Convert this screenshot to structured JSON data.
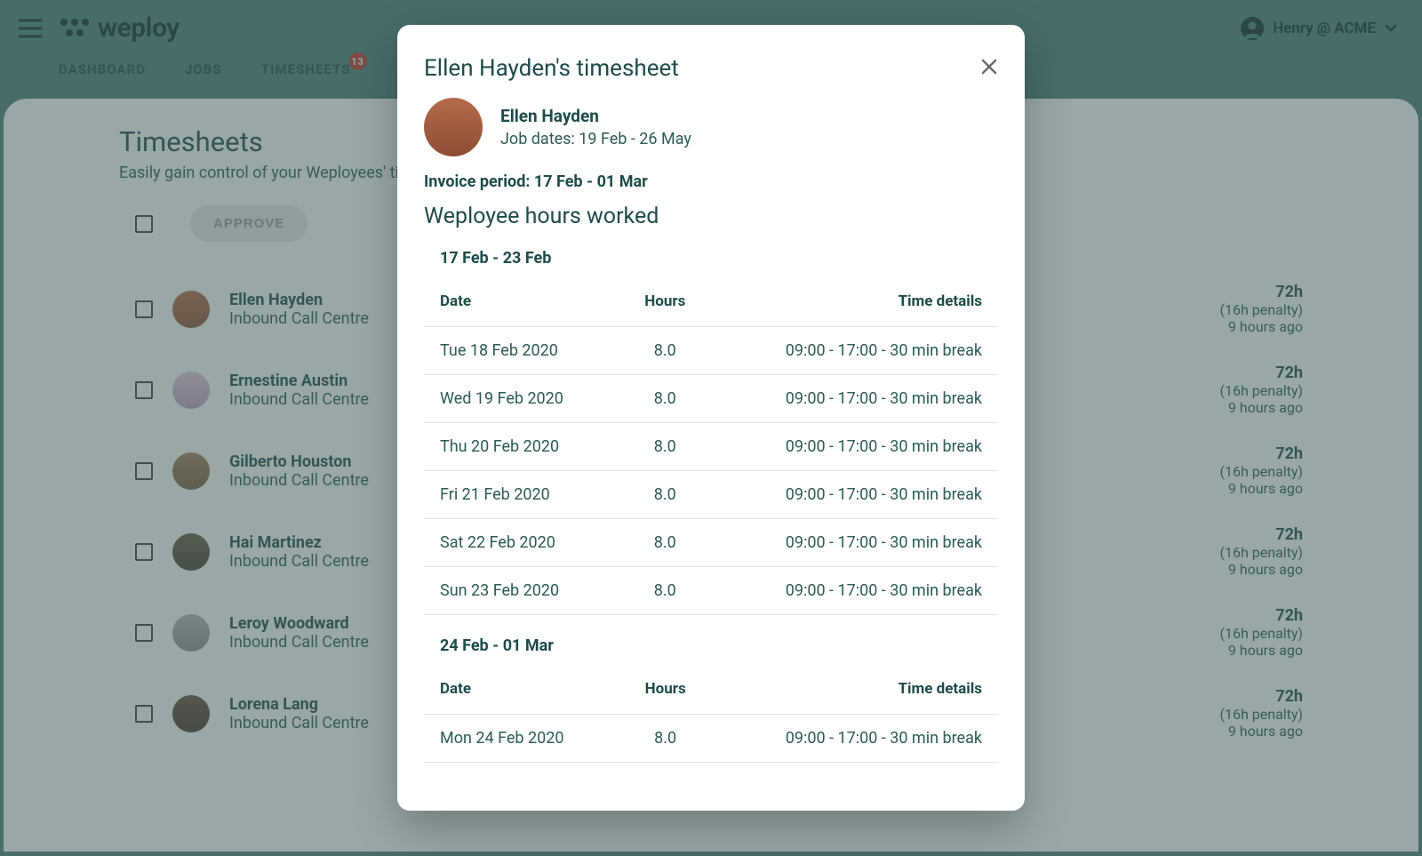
{
  "header": {
    "logo_text": "weploy",
    "user_label": "Henry @ ACME"
  },
  "nav": {
    "dashboard": "DASHBOARD",
    "jobs": "JOBS",
    "timesheets": "TIMESHEETS",
    "timesheets_badge": "13"
  },
  "page": {
    "title": "Timesheets",
    "subtitle": "Easily gain control of your Weployees' tim",
    "approve_label": "APPROVE"
  },
  "timesheet_rows": [
    {
      "name": "Ellen Hayden",
      "role": "Inbound Call Centre",
      "hours": "72h",
      "penalty": "(16h penalty)",
      "ago": "9 hours ago"
    },
    {
      "name": "Ernestine Austin",
      "role": "Inbound Call Centre",
      "hours": "72h",
      "penalty": "(16h penalty)",
      "ago": "9 hours ago"
    },
    {
      "name": "Gilberto Houston",
      "role": "Inbound Call Centre",
      "hours": "72h",
      "penalty": "(16h penalty)",
      "ago": "9 hours ago"
    },
    {
      "name": "Hai Martinez",
      "role": "Inbound Call Centre",
      "hours": "72h",
      "penalty": "(16h penalty)",
      "ago": "9 hours ago"
    },
    {
      "name": "Leroy Woodward",
      "role": "Inbound Call Centre",
      "hours": "72h",
      "penalty": "(16h penalty)",
      "ago": "9 hours ago"
    },
    {
      "name": "Lorena Lang",
      "role": "Inbound Call Centre",
      "hours": "72h",
      "penalty": "(16h penalty)",
      "ago": "9 hours ago"
    }
  ],
  "modal": {
    "title": "Ellen Hayden's timesheet",
    "name": "Ellen Hayden",
    "job_dates": "Job dates: 19 Feb - 26 May",
    "invoice_period": "Invoice period: 17 Feb - 01 Mar",
    "hours_heading": "Weployee hours worked",
    "table_headers": {
      "date": "Date",
      "hours": "Hours",
      "details": "Time details"
    },
    "weeks": [
      {
        "label": "17 Feb - 23 Feb",
        "rows": [
          {
            "date": "Tue 18 Feb 2020",
            "hours": "8.0",
            "details": "09:00 - 17:00 - 30 min break"
          },
          {
            "date": "Wed 19 Feb 2020",
            "hours": "8.0",
            "details": "09:00 - 17:00 - 30 min break"
          },
          {
            "date": "Thu 20 Feb 2020",
            "hours": "8.0",
            "details": "09:00 - 17:00 - 30 min break"
          },
          {
            "date": "Fri 21 Feb 2020",
            "hours": "8.0",
            "details": "09:00 - 17:00 - 30 min break"
          },
          {
            "date": "Sat 22 Feb 2020",
            "hours": "8.0",
            "details": "09:00 - 17:00 - 30 min break"
          },
          {
            "date": "Sun 23 Feb 2020",
            "hours": "8.0",
            "details": "09:00 - 17:00 - 30 min break"
          }
        ]
      },
      {
        "label": "24 Feb - 01 Mar",
        "rows": [
          {
            "date": "Mon 24 Feb 2020",
            "hours": "8.0",
            "details": "09:00 - 17:00 - 30 min break"
          }
        ]
      }
    ]
  }
}
